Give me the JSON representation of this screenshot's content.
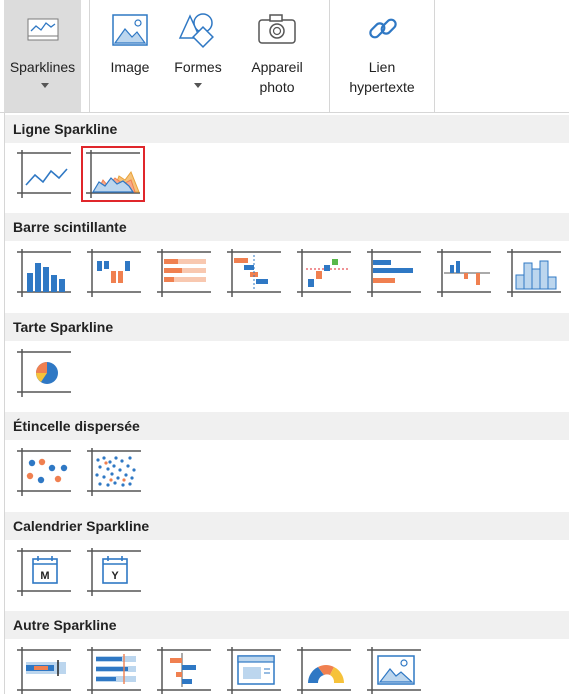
{
  "ribbon": {
    "sparklines_label": "Sparklines",
    "image_label": "Image",
    "formes_label": "Formes",
    "appareil_line1": "Appareil",
    "appareil_line2": "photo",
    "lien_line1": "Lien",
    "lien_line2": "hypertexte"
  },
  "sections": [
    {
      "title": "Ligne Sparkline",
      "items": [
        "line-sparkline-icon",
        "area-sparkline-icon"
      ]
    },
    {
      "title": "Barre scintillante",
      "items": [
        "column-icon",
        "winloss-icon",
        "stacked-bar-icon",
        "waterfall-icon",
        "cascade-icon",
        "horizontal-bar-icon",
        "vertical-variance-icon",
        "histogram-icon"
      ]
    },
    {
      "title": "Tarte Sparkline",
      "items": [
        "pie-icon"
      ]
    },
    {
      "title": "Étincelle dispersée",
      "items": [
        "scatter-icon",
        "dense-scatter-icon"
      ]
    },
    {
      "title": "Calendrier Sparkline",
      "items": [
        "month-calendar-icon",
        "year-calendar-icon"
      ]
    },
    {
      "title": "Autre Sparkline",
      "items": [
        "bullet-icon",
        "spread-icon",
        "variance-icon",
        "image-sparkline-icon",
        "gauge-icon",
        "picture-icon"
      ]
    }
  ],
  "calendar": {
    "month_letter": "M",
    "year_letter": "Y"
  },
  "selected_item": "area-sparkline-icon",
  "colors": {
    "blue": "#2f78c4",
    "orange": "#f08050",
    "red_outline": "#e0262b",
    "axis": "#555555"
  }
}
